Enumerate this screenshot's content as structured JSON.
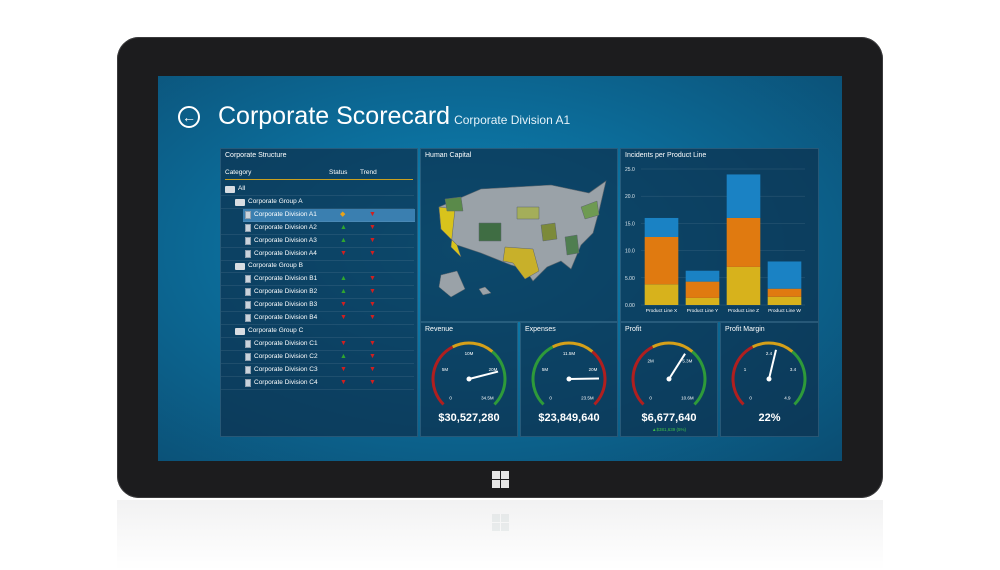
{
  "header": {
    "title": "Corporate Scorecard",
    "subtitle": "Corporate Division A1"
  },
  "structure": {
    "title": "Corporate Structure",
    "columns": [
      "Category",
      "Status",
      "Trend"
    ],
    "rows": [
      {
        "label": "All",
        "level": 0,
        "type": "folder",
        "status": "",
        "trend": ""
      },
      {
        "label": "Corporate Group A",
        "level": 1,
        "type": "folder",
        "status": "",
        "trend": ""
      },
      {
        "label": "Corporate Division A1",
        "level": 2,
        "type": "doc",
        "status": "diamond",
        "trend": "down",
        "selected": true
      },
      {
        "label": "Corporate Division A2",
        "level": 2,
        "type": "doc",
        "status": "up",
        "trend": "down"
      },
      {
        "label": "Corporate Division A3",
        "level": 2,
        "type": "doc",
        "status": "up",
        "trend": "down"
      },
      {
        "label": "Corporate Division A4",
        "level": 2,
        "type": "doc",
        "status": "down",
        "trend": "down"
      },
      {
        "label": "Corporate Group B",
        "level": 1,
        "type": "folder",
        "status": "",
        "trend": ""
      },
      {
        "label": "Corporate Division B1",
        "level": 2,
        "type": "doc",
        "status": "up",
        "trend": "down"
      },
      {
        "label": "Corporate Division B2",
        "level": 2,
        "type": "doc",
        "status": "up",
        "trend": "down"
      },
      {
        "label": "Corporate Division B3",
        "level": 2,
        "type": "doc",
        "status": "down",
        "trend": "down"
      },
      {
        "label": "Corporate Division B4",
        "level": 2,
        "type": "doc",
        "status": "down",
        "trend": "down"
      },
      {
        "label": "Corporate Group C",
        "level": 1,
        "type": "folder",
        "status": "",
        "trend": ""
      },
      {
        "label": "Corporate Division C1",
        "level": 2,
        "type": "doc",
        "status": "down",
        "trend": "down"
      },
      {
        "label": "Corporate Division C2",
        "level": 2,
        "type": "doc",
        "status": "up",
        "trend": "down"
      },
      {
        "label": "Corporate Division C3",
        "level": 2,
        "type": "doc",
        "status": "down",
        "trend": "down"
      },
      {
        "label": "Corporate Division C4",
        "level": 2,
        "type": "doc",
        "status": "down",
        "trend": "down"
      }
    ]
  },
  "human_capital": {
    "title": "Human Capital"
  },
  "incidents": {
    "title": "Incidents per Product Line",
    "chart_data": {
      "type": "bar",
      "stacked": true,
      "categories": [
        "Product Line X",
        "Product Line Y",
        "Product Line Z",
        "Product Line W"
      ],
      "series": [
        {
          "color": "#d7b21c",
          "values": [
            3.8,
            1.3,
            7.0,
            1.5
          ]
        },
        {
          "color": "#e07a10",
          "values": [
            8.7,
            3.0,
            9.0,
            1.5
          ]
        },
        {
          "color": "#1a82c4",
          "values": [
            3.5,
            2.0,
            8.0,
            5.0
          ]
        }
      ],
      "yticks": [
        "0.00",
        "5.00",
        "10.0",
        "15.0",
        "20.0",
        "25.0"
      ],
      "ylim": [
        0,
        25
      ]
    }
  },
  "gauges": [
    {
      "title": "Revenue",
      "value": "$30,527,280",
      "sub": "",
      "labels": [
        "0",
        "5M",
        "10M",
        "20M",
        "34.5M"
      ],
      "needle": 0.78
    },
    {
      "title": "Expenses",
      "value": "$23,849,640",
      "sub": "",
      "labels": [
        "0",
        "5M",
        "11.5M",
        "20M",
        "23.5M"
      ],
      "needle": 0.83
    },
    {
      "title": "Profit",
      "value": "$6,677,640",
      "sub": "▲$381,639 (5%)",
      "labels": [
        "0",
        "2M",
        "5.3M",
        "10.6M"
      ],
      "needle": 0.62
    },
    {
      "title": "Profit Margin",
      "value": "22%",
      "sub": "",
      "labels": [
        "0",
        "1",
        "2.4",
        "3.4",
        "4.9"
      ],
      "needle": 0.55
    }
  ],
  "colors": {
    "up": "#2fa62f",
    "down": "#d21f1f",
    "diamond": "#e8a31a",
    "accent": "#c9a020",
    "sub_green": "#3fc04a",
    "sub_red": "#e05050"
  }
}
